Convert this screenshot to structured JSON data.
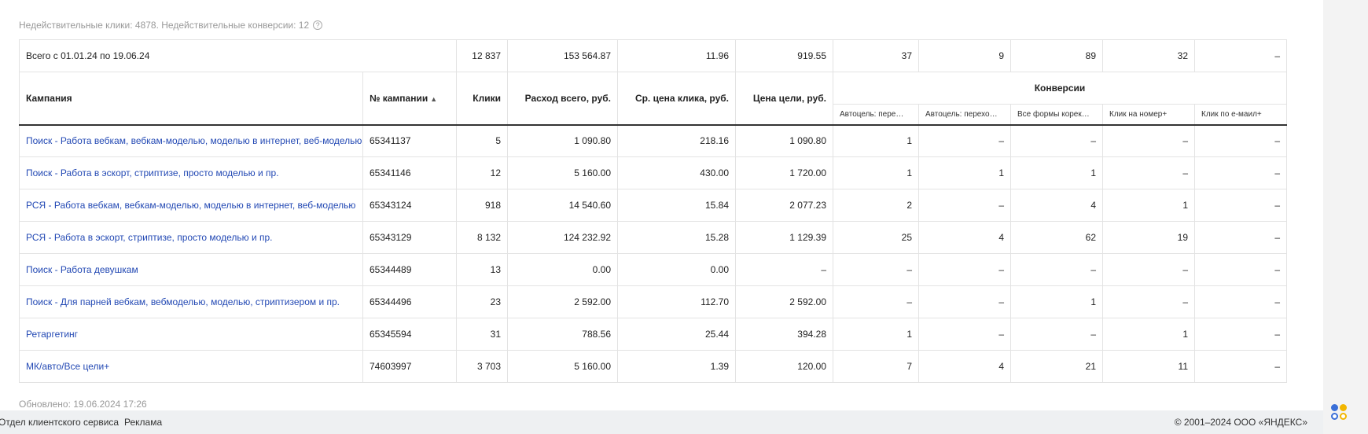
{
  "notice": {
    "text": "Недействительные клики: 4878. Недействительные конверсии: 12",
    "help_icon": "?"
  },
  "total": {
    "label": "Всего с 01.01.24 по 19.06.24",
    "clicks": "12 837",
    "cost": "153 564.87",
    "avg_cpc": "11.96",
    "goal_price": "919.55",
    "conv": [
      "37",
      "9",
      "89",
      "32",
      "–"
    ]
  },
  "headers": {
    "campaign": "Кампания",
    "campaign_id": "№ кампании",
    "sort_arrow": "▲",
    "clicks": "Клики",
    "cost": "Расход всего, руб.",
    "avg_cpc": "Ср. цена клика, руб.",
    "goal_price": "Цена цели, руб.",
    "conversions": "Конверсии",
    "conv_sub": [
      "Автоцель: пере…",
      "Автоцель: перехо…",
      "Все формы корек…",
      "Клик на номер+",
      "Клик по е-маил+"
    ]
  },
  "rows": [
    {
      "name": "Поиск - Работа вебкам, вебкам-моделью, моделью в интернет, веб-моделью",
      "id": "65341137",
      "clicks": "5",
      "cost": "1 090.80",
      "cpc": "218.16",
      "goal": "1 090.80",
      "conv": [
        "1",
        "–",
        "–",
        "–",
        "–"
      ]
    },
    {
      "name": "Поиск - Работа в эскорт, стриптизе, просто моделью и пр.",
      "id": "65341146",
      "clicks": "12",
      "cost": "5 160.00",
      "cpc": "430.00",
      "goal": "1 720.00",
      "conv": [
        "1",
        "1",
        "1",
        "–",
        "–"
      ]
    },
    {
      "name": "РСЯ - Работа вебкам, вебкам-моделью, моделью в интернет, веб-моделью",
      "id": "65343124",
      "clicks": "918",
      "cost": "14 540.60",
      "cpc": "15.84",
      "goal": "2 077.23",
      "conv": [
        "2",
        "–",
        "4",
        "1",
        "–"
      ]
    },
    {
      "name": "РСЯ - Работа в эскорт, стриптизе, просто моделью и пр.",
      "id": "65343129",
      "clicks": "8 132",
      "cost": "124 232.92",
      "cpc": "15.28",
      "goal": "1 129.39",
      "conv": [
        "25",
        "4",
        "62",
        "19",
        "–"
      ]
    },
    {
      "name": "Поиск - Работа девушкам",
      "id": "65344489",
      "clicks": "13",
      "cost": "0.00",
      "cpc": "0.00",
      "goal": "–",
      "conv": [
        "–",
        "–",
        "–",
        "–",
        "–"
      ]
    },
    {
      "name": "Поиск - Для парней вебкам, вебмоделью, моделью, стриптизером и пр.",
      "id": "65344496",
      "clicks": "23",
      "cost": "2 592.00",
      "cpc": "112.70",
      "goal": "2 592.00",
      "conv": [
        "–",
        "–",
        "1",
        "–",
        "–"
      ]
    },
    {
      "name": "Ретаргетинг",
      "id": "65345594",
      "clicks": "31",
      "cost": "788.56",
      "cpc": "25.44",
      "goal": "394.28",
      "conv": [
        "1",
        "–",
        "–",
        "1",
        "–"
      ]
    },
    {
      "name": "МК/авто/Все цели+",
      "id": "74603997",
      "clicks": "3 703",
      "cost": "5 160.00",
      "cpc": "1.39",
      "goal": "120.00",
      "conv": [
        "7",
        "4",
        "21",
        "11",
        "–"
      ]
    }
  ],
  "updated": "Обновлено: 19.06.2024 17:26",
  "footer": {
    "links": [
      "Отдел клиентского сервиса",
      "Реклама"
    ],
    "copyright": "© 2001–2024 ООО «ЯНДЕКС»"
  },
  "colors": {
    "link": "#2349b4",
    "muted": "#999999",
    "border": "#e3e3e3",
    "footer_bg": "#eef0f2"
  }
}
